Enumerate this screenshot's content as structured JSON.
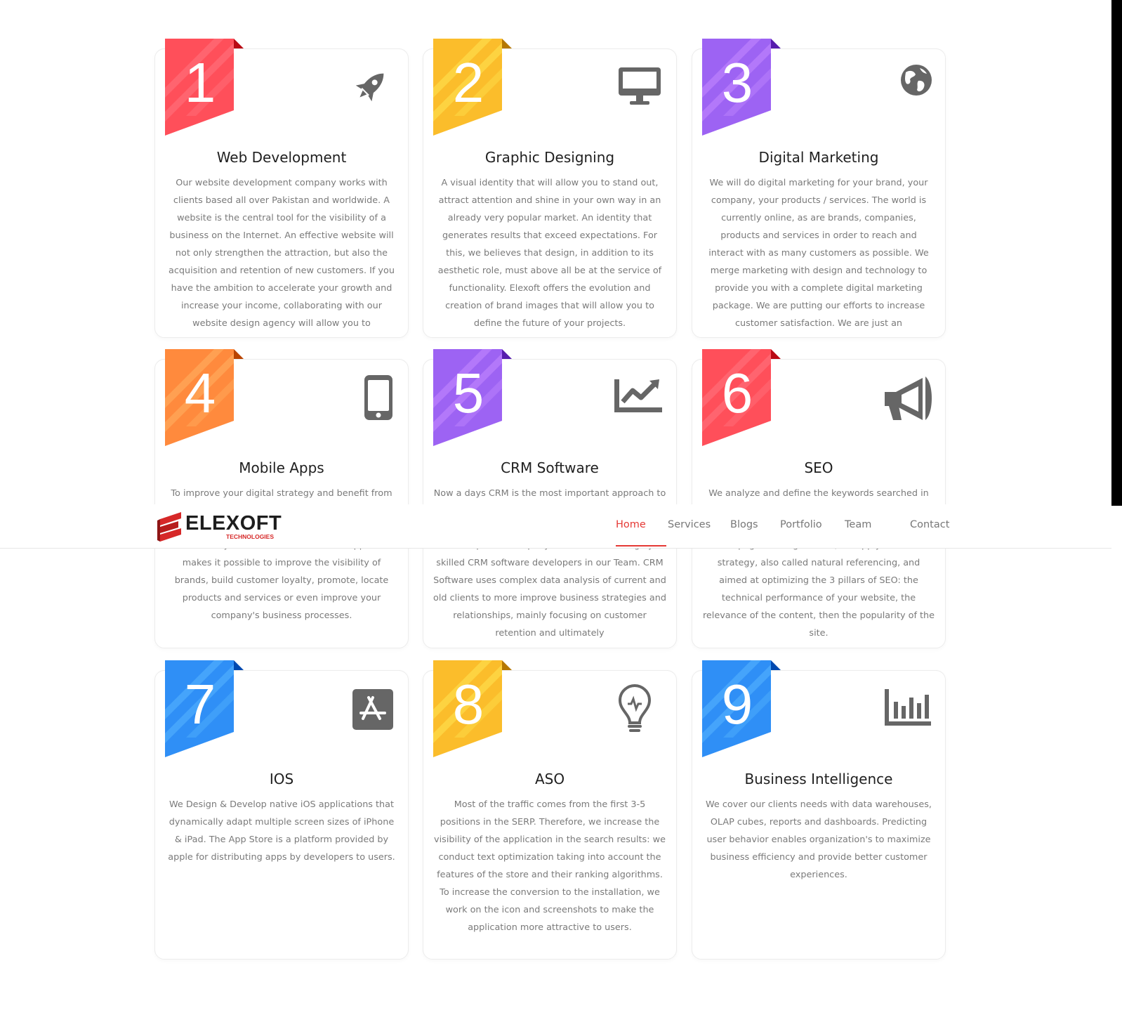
{
  "header": {
    "logo_main": "ELEXOFT",
    "logo_sub": "TECHNOLOGIES",
    "nav": [
      "Home",
      "Services",
      "Blogs",
      "Portfolio",
      "Team",
      "Contact"
    ],
    "active_nav": "Home",
    "accent_color": "#e53935"
  },
  "cards": [
    {
      "number": "1",
      "icon": "rocket-icon",
      "color": "#ff4f5a",
      "title": "Web Development",
      "description": "Our website development company works with clients based all over Pakistan and worldwide. A website is the central tool for the visibility of a business on the Internet. An effective website will not only strengthen the attraction, but also the acquisition and retention of new customers. If you have the ambition to accelerate your growth and increase your income, collaborating with our website design agency will allow you to"
    },
    {
      "number": "2",
      "icon": "desktop-icon",
      "color": "#fbbd2b",
      "title": "Graphic Designing",
      "description": "A visual identity that will allow you to stand out, attract attention and shine in your own way in an already very popular market. An identity that generates results that exceed expectations. For this, we believes that design, in addition to its aesthetic role, must above all be at the service of functionality. Elexoft offers the evolution and creation of brand images that will allow you to define the future of your projects."
    },
    {
      "number": "3",
      "icon": "globe-icon",
      "color": "#9d63f3",
      "title": "Digital Marketing",
      "description": "We will do digital marketing for your brand, your company, your products / services. The world is currently online, as are brands, companies, products and services in order to reach and interact with as many customers as possible. We merge marketing with design and technology to provide you with a complete digital marketing package. We are putting our efforts to increase customer satisfaction. We are just an"
    },
    {
      "number": "4",
      "icon": "mobile-icon",
      "color": "#ff8a3d",
      "title": "Mobile Apps",
      "description_top": "To improve your digital strategy and benefit from all",
      "description": "channels for your business. A dedicated application makes it possible to improve the visibility of brands, build customer loyalty, promote, locate products and services or even improve your company's business processes."
    },
    {
      "number": "5",
      "icon": "chart-line-icon",
      "color": "#9d63f3",
      "title": "CRM Software",
      "description_top": "Now a days CRM is the most important approach to",
      "description": "development company in Pakistan with highly skilled CRM software developers in our Team. CRM Software uses complex data analysis of current and old clients to more improve business strategies and relationships, mainly focusing on customer retention and ultimately"
    },
    {
      "number": "6",
      "icon": "megaphone-icon",
      "color": "#ff4f5a",
      "title": "SEO",
      "description_top": "We analyze and define the keywords searched in",
      "description": "1st page of Google. Then, we apply an SEO strategy, also called natural referencing, and aimed at optimizing the 3 pillars of SEO: the technical performance of your website, the relevance of the content, then the popularity of the site."
    },
    {
      "number": "7",
      "icon": "app-store-icon",
      "color": "#2f8ff6",
      "title": "IOS",
      "description": "We Design & Develop native iOS applications that dynamically adapt multiple screen sizes of iPhone & iPad. The App Store is a platform provided by apple for distributing apps by developers to users."
    },
    {
      "number": "8",
      "icon": "lightbulb-icon",
      "color": "#fbbd2b",
      "title": "ASO",
      "description": "Most of the traffic comes from the first 3-5 positions in the SERP. Therefore, we increase the visibility of the application in the search results: we conduct text optimization taking into account the features of the store and their ranking algorithms. To increase the conversion to the installation, we work on the icon and screenshots to make the application more attractive to users."
    },
    {
      "number": "9",
      "icon": "bar-chart-icon",
      "color": "#2f8ff6",
      "title": "Business Intelligence",
      "description": "We cover our clients needs with data warehouses, OLAP cubes, reports and dashboards. Predicting user behavior enables organization's to maximize business efficiency and provide better customer experiences."
    }
  ]
}
